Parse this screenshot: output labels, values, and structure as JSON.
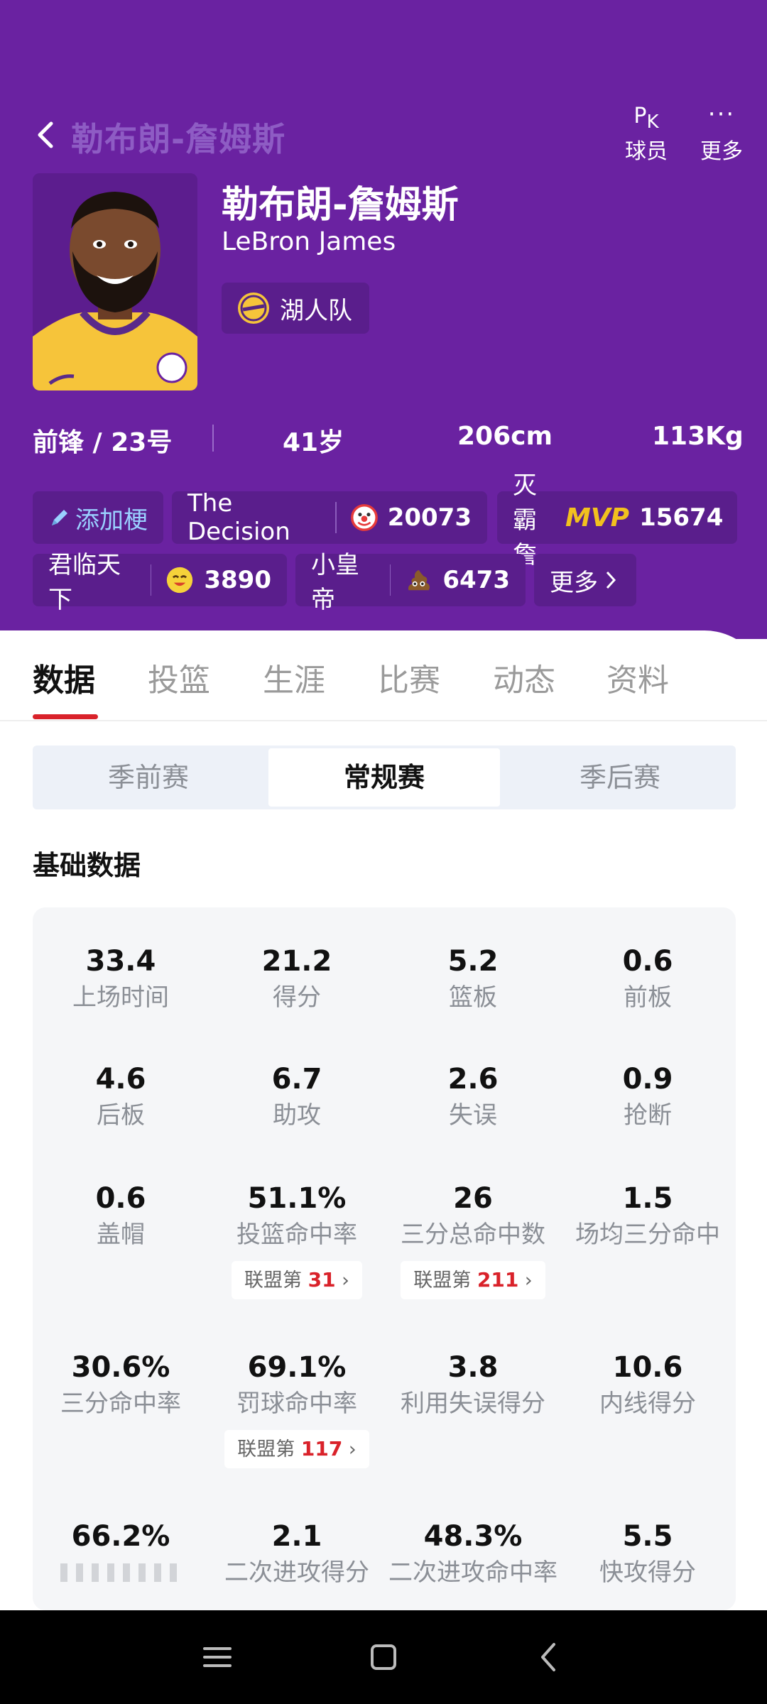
{
  "header": {
    "title": "勒布朗-詹姆斯",
    "pk_label": "球员",
    "more_label": "更多"
  },
  "player": {
    "name_cn": "勒布朗-詹姆斯",
    "name_en": "LeBron James",
    "team": "湖人队",
    "position_number": "前锋 / 23号",
    "age": "41岁",
    "height": "206cm",
    "weight": "113Kg"
  },
  "tags": {
    "add_label": "添加梗",
    "items": [
      {
        "text": "The Decision",
        "emoji": "clown",
        "count": "20073"
      },
      {
        "text": "灭霸詹",
        "emoji": "mvp",
        "count": "15674"
      },
      {
        "text": "君临天下",
        "emoji": "happy-face",
        "count": "3890"
      },
      {
        "text": "小皇帝",
        "emoji": "poop",
        "count": "6473"
      }
    ],
    "more_label": "更多"
  },
  "tabs": [
    "数据",
    "投篮",
    "生涯",
    "比赛",
    "动态",
    "资料"
  ],
  "active_tab": "数据",
  "season_types": [
    "季前赛",
    "常规赛",
    "季后赛"
  ],
  "active_season_type": "常规赛",
  "section_title": "基础数据",
  "rank_prefix": "联盟第",
  "stats": [
    {
      "value": "33.4",
      "label": "上场时间"
    },
    {
      "value": "21.2",
      "label": "得分"
    },
    {
      "value": "5.2",
      "label": "篮板"
    },
    {
      "value": "0.6",
      "label": "前板"
    },
    {
      "value": "4.6",
      "label": "后板"
    },
    {
      "value": "6.7",
      "label": "助攻"
    },
    {
      "value": "2.6",
      "label": "失误"
    },
    {
      "value": "0.9",
      "label": "抢断"
    },
    {
      "value": "0.6",
      "label": "盖帽"
    },
    {
      "value": "51.1%",
      "label": "投篮命中率",
      "rank": "31"
    },
    {
      "value": "26",
      "label": "三分总命中数",
      "rank": "211"
    },
    {
      "value": "1.5",
      "label": "场均三分命中"
    },
    {
      "value": "30.6%",
      "label": "三分命中率"
    },
    {
      "value": "69.1%",
      "label": "罚球命中率",
      "rank": "117"
    },
    {
      "value": "3.8",
      "label": "利用失误得分"
    },
    {
      "value": "10.6",
      "label": "内线得分"
    },
    {
      "value": "66.2%",
      "label": ""
    },
    {
      "value": "2.1",
      "label": "二次进攻得分"
    },
    {
      "value": "48.3%",
      "label": "二次进攻命中率"
    },
    {
      "value": "5.5",
      "label": "快攻得分"
    }
  ],
  "colors": {
    "hero_bg": "#6a22a1",
    "accent_red": "#d9222a",
    "tag_bg": "#5a1e8c"
  }
}
